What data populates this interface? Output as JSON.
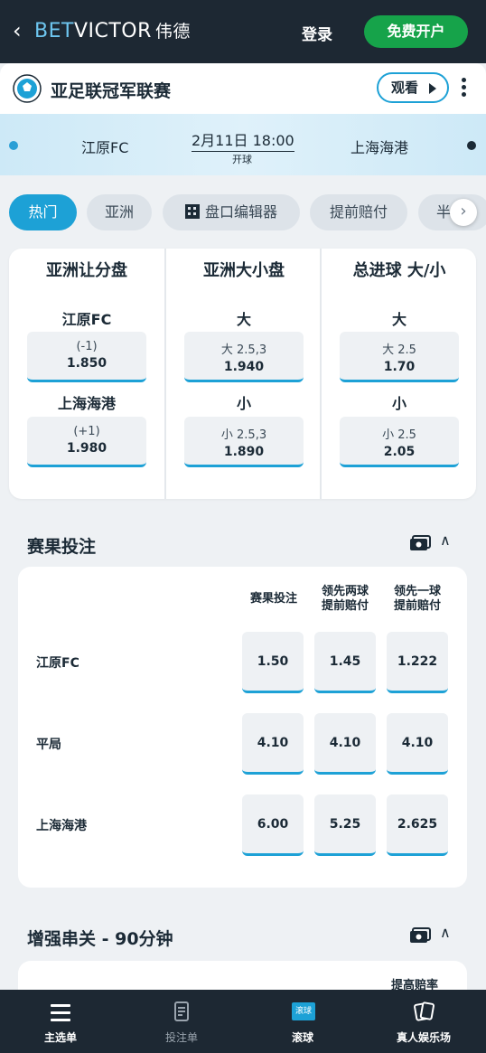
{
  "header": {
    "brand_bet": "BET",
    "brand_victor": "VICTOR",
    "brand_cn": "伟德",
    "login": "登录",
    "signup": "免费开户"
  },
  "match": {
    "league": "亚足联冠军联赛",
    "watch": "观看",
    "home": "江原FC",
    "away": "上海海港",
    "kickoff": "2月11日 18:00",
    "kickoff_sub": "开球"
  },
  "tabs": [
    {
      "label": "热门",
      "active": true
    },
    {
      "label": "亚洲"
    },
    {
      "label": "盘口编辑器"
    },
    {
      "label": "提前赔付"
    },
    {
      "label": "半"
    }
  ],
  "markets": [
    {
      "title": "亚洲让分盘",
      "rows": [
        {
          "label": "江原FC",
          "line": "(-1)",
          "odds": "1.850"
        },
        {
          "label": "上海海港",
          "line": "(+1)",
          "odds": "1.980"
        }
      ]
    },
    {
      "title": "亚洲大小盘",
      "rows": [
        {
          "label": "大",
          "line": "大 2.5,3",
          "odds": "1.940"
        },
        {
          "label": "小",
          "line": "小 2.5,3",
          "odds": "1.890"
        }
      ]
    },
    {
      "title": "总进球 大/小",
      "rows": [
        {
          "label": "大",
          "line": "大 2.5",
          "odds": "1.70"
        },
        {
          "label": "小",
          "line": "小 2.5",
          "odds": "2.05"
        }
      ]
    }
  ],
  "result_section": {
    "title": "赛果投注",
    "headers": [
      {
        "l1": "赛果投注",
        "l2": ""
      },
      {
        "l1": "领先两球",
        "l2": "提前赔付"
      },
      {
        "l1": "领先一球",
        "l2": "提前赔付"
      }
    ],
    "rows": [
      {
        "label": "江原FC",
        "odds": [
          "1.50",
          "1.45",
          "1.222"
        ]
      },
      {
        "label": "平局",
        "odds": [
          "4.10",
          "4.10",
          "4.10"
        ]
      },
      {
        "label": "上海海港",
        "odds": [
          "6.00",
          "5.25",
          "2.625"
        ]
      }
    ]
  },
  "enhanced_section": {
    "title": "增强串关 - 90分钟",
    "sub": "提高赔率"
  },
  "bottom_nav": [
    {
      "label": "主选单",
      "icon": "menu-icon",
      "active": true
    },
    {
      "label": "投注单",
      "icon": "betslip-icon",
      "active": false
    },
    {
      "label": "滚球",
      "icon": "live-icon",
      "badge": "滚球",
      "active": true
    },
    {
      "label": "真人娱乐场",
      "icon": "cards-icon",
      "active": true
    }
  ],
  "colors": {
    "header_bg": "#1d2833",
    "accent": "#1da1d6",
    "signup_green": "#16a34a"
  }
}
